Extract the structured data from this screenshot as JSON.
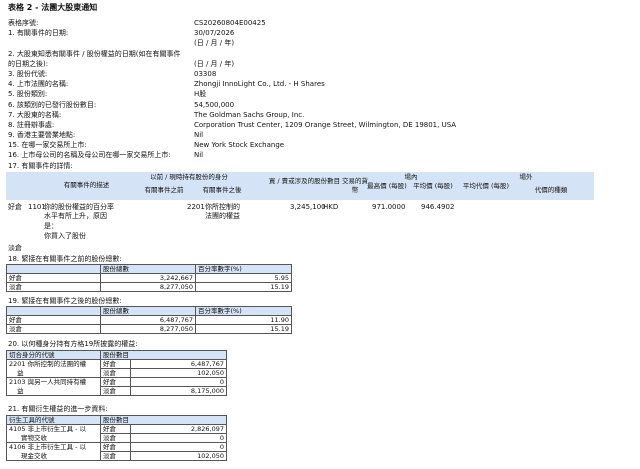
{
  "title": "表格 2 - 法團大股東通知",
  "info": [
    {
      "label": "表格序號:",
      "value": "CS20260804E00425"
    },
    {
      "label": "1. 有關事件的日期:",
      "value": "30/07/2026"
    },
    {
      "label": "",
      "value": "(日 / 月 / 年)"
    },
    {
      "label": "2. 大股東知悉有關事件 / 股份權益的日期(如在有關事件",
      "value": ""
    },
    {
      "label": "的日期之後):",
      "value": "(日 / 月 / 年)"
    },
    {
      "label": "3. 股份代號:",
      "value": "03308"
    },
    {
      "label": "4. 上市法團的名稱:",
      "value": "Zhongji InnoLight Co., Ltd. - H Shares"
    },
    {
      "label": "5. 股份類別:",
      "value": "H股"
    },
    {
      "label": "6. 該類別的已發行股份數目:",
      "value": "54,500,000"
    },
    {
      "label": "7. 大股東的名稱:",
      "value": "The Goldman Sachs Group, Inc."
    },
    {
      "label": "8. 註冊辦事處:",
      "value": "Corporation Trust Center, 1209 Orange Street, Wilmington, DE 19801, USA"
    },
    {
      "label": "9. 香港主要營業地點:",
      "value": "Nil"
    },
    {
      "label": "15. 在哪一家交易所上市:",
      "value": "New York Stock Exchange"
    },
    {
      "label": "16. 上市母公司的名稱及母公司在哪一家交易所上市:",
      "value": "Nil"
    },
    {
      "label": "17. 有關事件的詳情:",
      "value": ""
    }
  ],
  "event": {
    "headers": {
      "event_code": "有關事件的描述",
      "before": "以前 / 現時持有股份的身分",
      "before_code": "有關事件之前",
      "after_code": "有關事件之後",
      "shares": "買 / 賣或涉及的股份數目",
      "currency": "交易的貨幣",
      "onex": "場內",
      "offex": "場外",
      "high": "最高價 (每股)",
      "avg": "平均價 (每股)",
      "avg_off": "平均代價 (每股)",
      "consideration": "代價的種類"
    },
    "row": {
      "side": "好倉",
      "code": "1101",
      "desc_lines": [
        "你的股份權益的百分率",
        "水平有所上升，原因",
        "是：",
        "你買入了股份"
      ],
      "before_code": "2201",
      "before_lines": [
        "你所控制的",
        "法團的權益"
      ],
      "shares": "3,245,100",
      "currency": "HKD",
      "high": "971.0000",
      "avg": "946.4902"
    },
    "short_label": "淡倉"
  },
  "sec18": {
    "title": "18. 緊接在有關事件之前的股份總數:",
    "col_shares": "股份總數",
    "col_pct": "百分率數字(%)",
    "rows": [
      {
        "side": "好倉",
        "shares": "3,242,667",
        "pct": "5.95"
      },
      {
        "side": "淡倉",
        "shares": "8,277,050",
        "pct": "15.19"
      }
    ]
  },
  "sec19": {
    "title": "19. 緊接在有關事件之後的股份總數:",
    "col_shares": "股份總數",
    "col_pct": "百分率數字(%)",
    "rows": [
      {
        "side": "好倉",
        "shares": "6,487,767",
        "pct": "11.90"
      },
      {
        "side": "淡倉",
        "shares": "8,277,050",
        "pct": "15.19"
      }
    ]
  },
  "sec20": {
    "title": "20. 以何種身分持有方格19所披露的權益:",
    "col_cap": "切合身分的代號",
    "col_shares": "股份數目",
    "rows": [
      {
        "cap1": "2201 你所控制的法團的權",
        "cap2": "益",
        "long": "好倉",
        "long_v": "6,487,767",
        "short": "淡倉",
        "short_v": "102,050"
      },
      {
        "cap1": "2103 與另一人共同持有權",
        "cap2": "益",
        "long": "好倉",
        "long_v": "0",
        "short": "淡倉",
        "short_v": "8,175,000"
      }
    ]
  },
  "sec21": {
    "title": "21. 有關衍生權益的進一步資料:",
    "col_code": "衍生工具的代號",
    "col_shares": "股份數目",
    "rows": [
      {
        "cap1": "4105 非上市衍生工具 - 以",
        "cap2": "實物交收",
        "long": "好倉",
        "long_v": "2,826,097",
        "short": "淡倉",
        "short_v": "0"
      },
      {
        "cap1": "4106 非上市衍生工具 - 以",
        "cap2": "現金交收",
        "long": "好倉",
        "long_v": "0",
        "short": "淡倉",
        "short_v": "102,050"
      }
    ]
  }
}
